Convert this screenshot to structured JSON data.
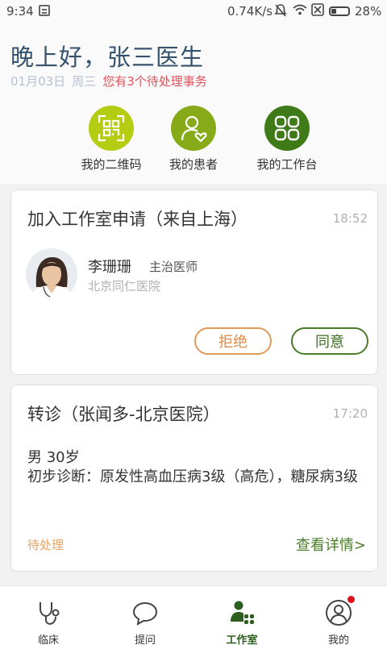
{
  "status_bar": {
    "time": "9:34",
    "net_speed": "0.74K/s",
    "battery": "28%"
  },
  "header": {
    "greeting": "晚上好，张三医生",
    "date": "01月03日",
    "weekday": "周三",
    "pending_notice": "您有3个待处理事务"
  },
  "shortcuts": [
    {
      "label": "我的二维码",
      "icon": "qr-code-icon",
      "color": "#b4cc12"
    },
    {
      "label": "我的患者",
      "icon": "patient-icon",
      "color": "#87ab18"
    },
    {
      "label": "我的工作台",
      "icon": "workbench-icon",
      "color": "#3e7a17"
    }
  ],
  "cards": {
    "join_request": {
      "title": "加入工作室申请（来自上海）",
      "time": "18:52",
      "doctor_name": "李珊珊",
      "doctor_title": "主治医师",
      "hospital": "北京同仁医院",
      "reject_label": "拒绝",
      "agree_label": "同意"
    },
    "referral": {
      "title": "转诊（张闻多-北京医院）",
      "time": "17:20",
      "patient_basic": "男  30岁",
      "diagnosis": "初步诊断：原发性高血压病3级（高危），糖尿病3级",
      "status": "待处理",
      "detail_link": "查看详情>"
    }
  },
  "tab_bar": {
    "tabs": [
      {
        "label": "临床",
        "icon": "stethoscope-icon"
      },
      {
        "label": "提问",
        "icon": "chat-bubble-icon"
      },
      {
        "label": "工作室",
        "icon": "studio-icon",
        "active": true
      },
      {
        "label": "我的",
        "icon": "profile-icon",
        "badge": true
      }
    ]
  },
  "colors": {
    "accent_green": "#3e7a17",
    "reject_orange": "#e08a45",
    "notice_red": "#e0535b",
    "title_blue": "#35536e"
  }
}
